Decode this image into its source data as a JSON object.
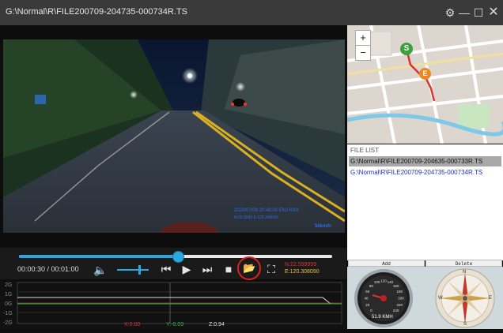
{
  "window": {
    "title": "G:\\Normal\\R\\FILE200709-204735-000734R.TS",
    "settings_icon": "⚙",
    "minimize_icon": "—",
    "maximize_icon": "☐",
    "close_icon": "✕"
  },
  "video": {
    "osd_datetime": "2020/07/09 20:48:00  ENJ RXX",
    "osd_coords": "N:22.5999   E:120.308090",
    "osd_speed": "56km/h"
  },
  "player": {
    "progress": 0.5,
    "time": "00:00:30 / 00:01:00",
    "volume": 0.75,
    "icons": {
      "volume": "🔈",
      "previous": "⏮",
      "play": "▶",
      "next": "⏭",
      "stop": "■",
      "open_folder": "📂",
      "snapshot": "⛶"
    },
    "latitude": "N:22.599999",
    "longitude": "E:120.308090",
    "accent": "#29a8e0"
  },
  "graph": {
    "y_labels": [
      "2G",
      "1G",
      "0G",
      "-1G",
      "-2G"
    ],
    "x_value": "X:0.00",
    "y_value": "Y:-0.03",
    "z_value": "Z:0.94",
    "x_color": "#e03030",
    "y_color": "#30c040",
    "z_color": "#e0e0e0"
  },
  "map": {
    "zoom_in": "+",
    "zoom_out": "−",
    "start_marker": "S",
    "end_marker": "E"
  },
  "file_list": {
    "label": "FILE LIST",
    "items": [
      "G:\\Normal\\R\\FILE200709-204635-000733R.TS",
      "G:\\Normal\\R\\FILE200709-204735-000734R.TS"
    ],
    "add_label": "Add",
    "delete_label": "Delete"
  },
  "speedometer": {
    "speed": "51.9 KMH",
    "ticks": [
      "0",
      "20",
      "40",
      "60",
      "80",
      "100",
      "120",
      "140",
      "160",
      "180",
      "200",
      "220",
      "240"
    ],
    "compass_north": "N",
    "compass_south": "S",
    "compass_east": "E",
    "compass_west": "W"
  }
}
